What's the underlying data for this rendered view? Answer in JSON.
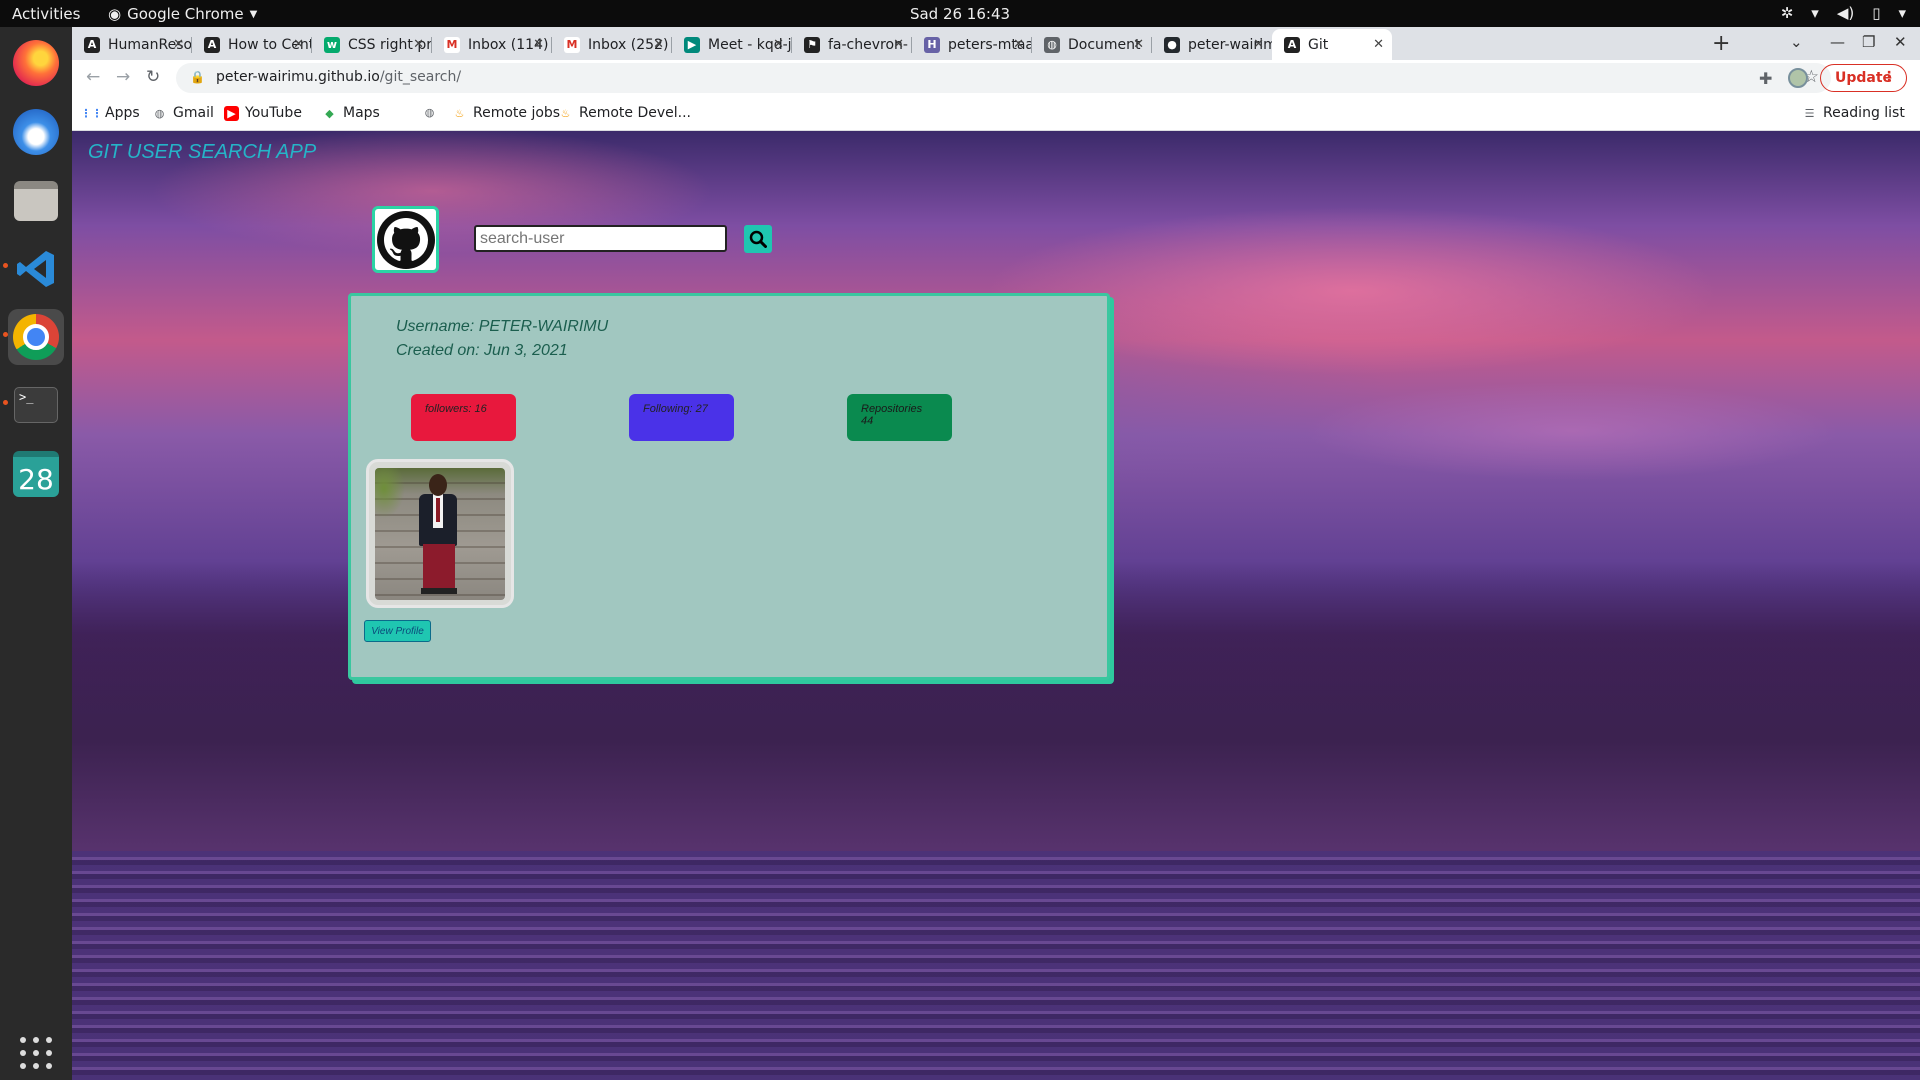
{
  "topbar": {
    "activities": "Activities",
    "app_name": "Google Chrome",
    "clock": "Sad 26  16:43"
  },
  "dock": {
    "items": [
      "firefox",
      "thunderbird",
      "files",
      "vscode",
      "chrome",
      "terminal",
      "calendar"
    ],
    "calendar_day": "28",
    "terminal_prompt": ">_"
  },
  "browser": {
    "tabs": [
      {
        "title": "HumanResou",
        "icon": "angular-icon"
      },
      {
        "title": "How to Cent",
        "icon": "angular-icon"
      },
      {
        "title": "CSS right pr",
        "icon": "w3schools-icon"
      },
      {
        "title": "Inbox (114)",
        "icon": "gmail-icon"
      },
      {
        "title": "Inbox (252)",
        "icon": "gmail-icon"
      },
      {
        "title": "Meet - kqd-jj",
        "icon": "meet-icon"
      },
      {
        "title": "fa-chevron-",
        "icon": "fontawesome-icon"
      },
      {
        "title": "peters-mtaa",
        "icon": "heroku-icon"
      },
      {
        "title": "Document",
        "icon": "globe-icon"
      },
      {
        "title": "peter-wairim",
        "icon": "github-icon"
      },
      {
        "title": "Git",
        "icon": "angular-icon"
      }
    ],
    "active_tab": 10,
    "url_host": "peter-wairimu.github.io",
    "url_path": "/git_search/",
    "update_label": "Update",
    "bookmarks": [
      {
        "label": "Apps",
        "icon": "apps-grid-icon"
      },
      {
        "label": "Gmail",
        "icon": "globe-icon"
      },
      {
        "label": "YouTube",
        "icon": "youtube-icon"
      },
      {
        "label": "Maps",
        "icon": "maps-icon"
      },
      {
        "label": "",
        "icon": "globe-icon"
      },
      {
        "label": "Remote jobs",
        "icon": "remote-icon"
      },
      {
        "label": "Remote Devel...",
        "icon": "remote-icon"
      }
    ],
    "reading_list": "Reading list"
  },
  "page": {
    "app_title": "GIT USER SEARCH APP",
    "search": {
      "placeholder": "search-user",
      "value": ""
    },
    "user": {
      "username_label": "Username: PETER-WAIRIMU",
      "created_label": "Created on: Jun 3, 2021",
      "followers_label": "followers: 16",
      "following_label": "Following: 27",
      "repos_label": "Repositories",
      "repos_count": "44",
      "view_profile": "View Profile"
    }
  },
  "colors": {
    "accent_teal": "#1fc6b1",
    "card_bg": "#a1c7c0",
    "followers": "#e8183d",
    "following": "#4a32e8",
    "repos": "#0a8a4f",
    "update_red": "#d93025"
  }
}
